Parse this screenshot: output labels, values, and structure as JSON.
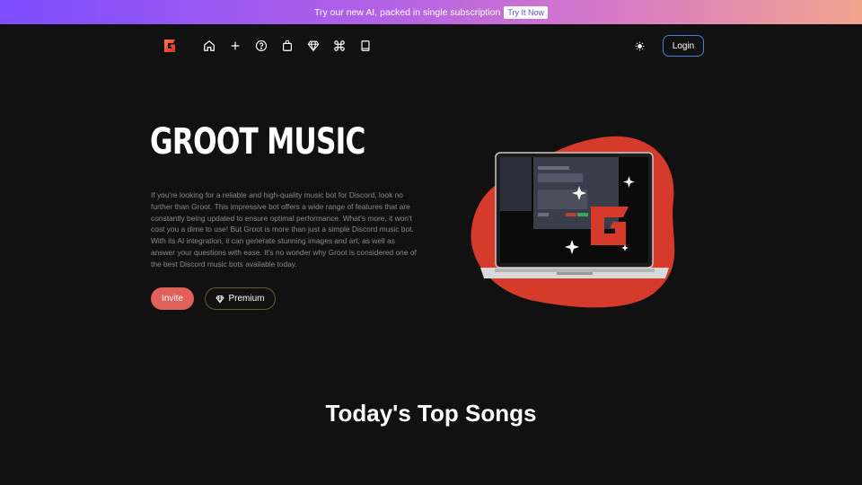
{
  "banner": {
    "text": "Try our new AI, packed in single subscription",
    "cta": "Try It Now"
  },
  "nav": {
    "logo_icon": "groot-g-logo",
    "icons": [
      "home-icon",
      "plus-icon",
      "help-icon",
      "shopping-bag-icon",
      "diamond-icon",
      "command-icon",
      "book-icon"
    ],
    "theme_icon": "sun-icon",
    "login_label": "Login"
  },
  "hero": {
    "title": "GROOT MUSIC",
    "description": "If you're looking for a reliable and high-quality music bot for Discord, look no further than Groot. This impressive bot offers a wide range of features that are constantly being updated to ensure optimal performance. What's more, it won't cost you a dime to use! But Groot is more than just a simple Discord music bot. With its AI integration, it can generate stunning images and art, as well as answer your questions with ease. It's no wonder why Groot is considered one of the best Discord music bots available today.",
    "invite_label": "Invite",
    "premium_label": "Premium"
  },
  "section": {
    "title": "Today's Top Songs"
  },
  "colors": {
    "accent_red": "#e0605a",
    "login_border": "#4a7bd8",
    "blob": "#d63a2a"
  }
}
